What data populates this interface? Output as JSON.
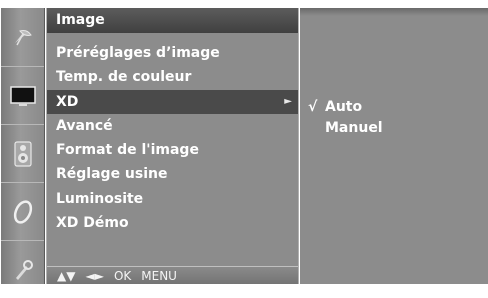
{
  "menu": {
    "title": "Image",
    "items": [
      {
        "label": "Préréglages d’image",
        "has_submenu": false
      },
      {
        "label": "Temp. de couleur",
        "has_submenu": false
      },
      {
        "label": "XD",
        "has_submenu": true,
        "arrow": "►"
      },
      {
        "label": "Avancé",
        "has_submenu": false
      },
      {
        "label": "Format de l'image",
        "has_submenu": false
      },
      {
        "label": "Réglage usine",
        "has_submenu": false
      },
      {
        "label": "Luminosite",
        "has_submenu": false
      },
      {
        "label": "XD Démo",
        "has_submenu": false
      }
    ],
    "selected_index": 2
  },
  "navigation": {
    "updown": "▲▼",
    "leftright": "◄►",
    "ok": "OK",
    "menu": "MENU"
  },
  "submenu": {
    "items": [
      {
        "label": "Auto",
        "checked": true,
        "check_mark": "√"
      },
      {
        "label": "Manuel",
        "checked": false,
        "check_mark": ""
      }
    ]
  },
  "sidebar_icons": [
    "satellite-dish-icon",
    "screen-icon",
    "speaker-icon",
    "clock-icon",
    "settings-icon"
  ],
  "colors": {
    "panel": "#8c8c8c",
    "selected_row": "#4a4a4a",
    "title_bar": "#4c4c4c",
    "text": "#ffffff"
  }
}
